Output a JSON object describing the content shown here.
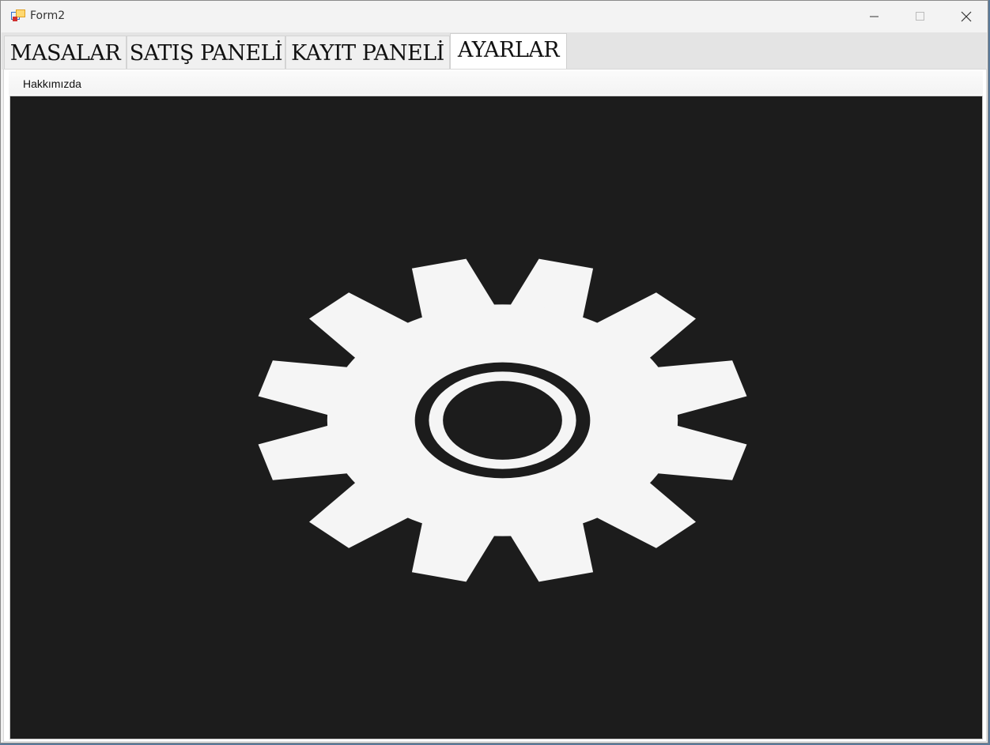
{
  "window": {
    "title": "Form2",
    "icon": "app-icon"
  },
  "tabs": [
    {
      "label": "MASALAR",
      "active": false
    },
    {
      "label": "SATIŞ PANELİ",
      "active": false
    },
    {
      "label": "KAYIT PANELİ",
      "active": false
    },
    {
      "label": "AYARLAR",
      "active": true
    }
  ],
  "menu": {
    "items": [
      {
        "label": "Hakkımızda"
      }
    ]
  },
  "picture": {
    "icon": "gear-icon",
    "background_color": "#1c1c1c",
    "icon_color": "#f5f5f5"
  }
}
